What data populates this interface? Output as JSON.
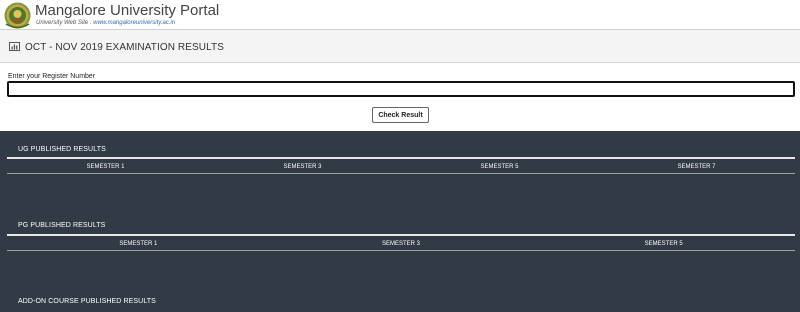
{
  "header": {
    "portal_title": "Mangalore University Portal",
    "website_prefix": "University Web Site : ",
    "website_url": "www.mangaloreuniversity.ac.in"
  },
  "page": {
    "title": "OCT - NOV 2019 EXAMINATION RESULTS",
    "title_icon": "bar-chart-icon"
  },
  "form": {
    "register_label": "Enter your Register Number",
    "register_value": "",
    "register_placeholder": "",
    "check_button": "Check Result"
  },
  "results": {
    "ug": {
      "title": "UG PUBLISHED RESULTS",
      "semesters": [
        "SEMESTER 1",
        "SEMESTER 3",
        "SEMESTER 5",
        "SEMESTER 7"
      ]
    },
    "pg": {
      "title": "PG PUBLISHED RESULTS",
      "semesters": [
        "SEMESTER 1",
        "SEMESTER 3",
        "SEMESTER 5"
      ]
    },
    "addon": {
      "title": "ADD-ON COURSE PUBLISHED RESULTS"
    }
  },
  "colors": {
    "results_background": "#323a46",
    "link": "#2f6db5"
  }
}
